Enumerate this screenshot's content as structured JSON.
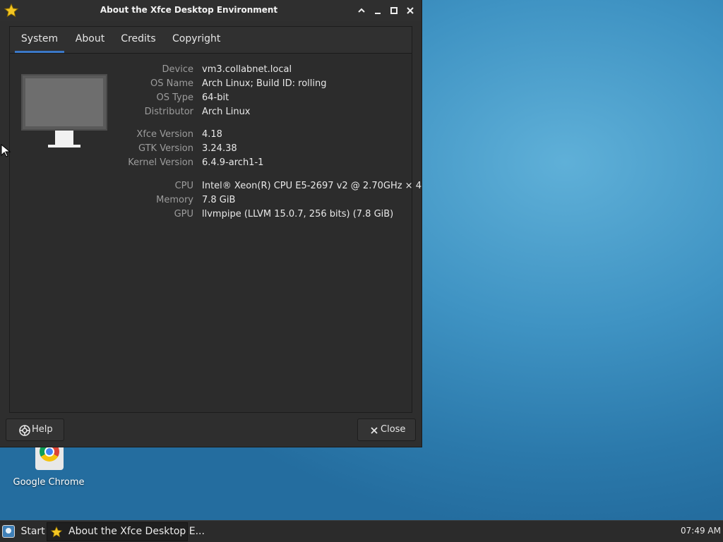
{
  "window": {
    "title": "About the Xfce Desktop Environment",
    "controls": {
      "rollup": "^",
      "minimize": "_",
      "maximize": "□",
      "close": "×"
    }
  },
  "tabs": [
    {
      "label": "System",
      "active": true
    },
    {
      "label": "About"
    },
    {
      "label": "Credits"
    },
    {
      "label": "Copyright"
    }
  ],
  "system": {
    "device_label": "Device",
    "device": "vm3.collabnet.local",
    "os_name_label": "OS Name",
    "os_name": "Arch Linux; Build ID: rolling",
    "os_type_label": "OS Type",
    "os_type": "64-bit",
    "distributor_label": "Distributor",
    "distributor": "Arch Linux",
    "xfce_label": "Xfce Version",
    "xfce": "4.18",
    "gtk_label": "GTK Version",
    "gtk": "3.24.38",
    "kernel_label": "Kernel Version",
    "kernel": "6.4.9-arch1-1",
    "cpu_label": "CPU",
    "cpu": "Intel® Xeon(R) CPU E5-2697 v2 @ 2.70GHz × 4",
    "memory_label": "Memory",
    "memory": "7.8 GiB",
    "gpu_label": "GPU",
    "gpu": "llvmpipe (LLVM 15.0.7, 256 bits) (7.8 GiB)"
  },
  "buttons": {
    "help": "Help",
    "close": "Close"
  },
  "desktop": {
    "chrome_label": "Google Chrome"
  },
  "taskbar": {
    "start": "Start",
    "task_item": "About the Xfce Desktop E...",
    "clock": "07:49 AM"
  },
  "colors": {
    "accent": "#3b78c7",
    "window_bg": "#2e2e2e",
    "taskbar_bg": "#2b2b2b"
  }
}
